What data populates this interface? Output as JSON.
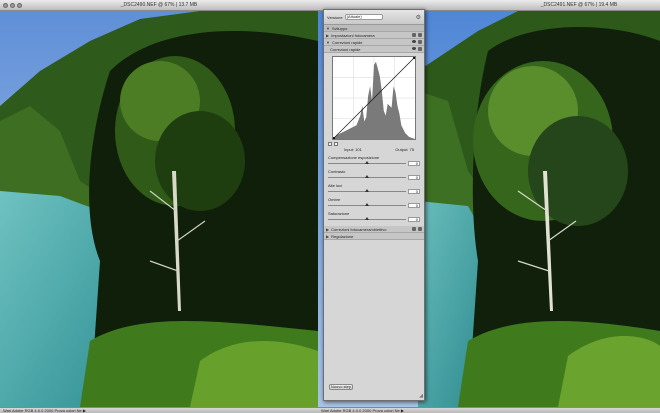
{
  "left_window": {
    "title": "_DSC2490.NEF @ 67% | 13.7 MB",
    "status": "Wari Adobe RGB 4.0.0 2000  Prova colori Ne  ▶"
  },
  "right_window": {
    "title": "_DSC2491.NEF @ 67% | 19.4 MB",
    "status": "Wari Adobe RGB 4.0.0 2000  Prova colori Ne  ▶"
  },
  "panel": {
    "version_label": "Versione",
    "version_value": "(Attuale)",
    "sections": {
      "sviluppo": "Sviluppo",
      "impostazioni_fotocamera": "Impostazioni fotocamera",
      "correzioni_rapide_1": "Correzioni rapide",
      "correzioni_rapide_2": "Correzioni rapide",
      "compensazione": "Correzioni fotocamera/obiettivo",
      "regolazione": "Regolazione"
    },
    "input_label": "Input:",
    "input_value": "101",
    "output_label": "Output:",
    "output_value": "75",
    "sliders": [
      {
        "label": "Compensazione esposizione",
        "value": "0",
        "pos": 0.5
      },
      {
        "label": "Contrasto",
        "value": "0",
        "pos": 0.5
      },
      {
        "label": "Alte luci",
        "value": "0",
        "pos": 0.5
      },
      {
        "label": "Ombre",
        "value": "0",
        "pos": 0.5
      },
      {
        "label": "Saturazione",
        "value": "0",
        "pos": 0.5
      }
    ],
    "bottom_button": "Nuovo step"
  }
}
